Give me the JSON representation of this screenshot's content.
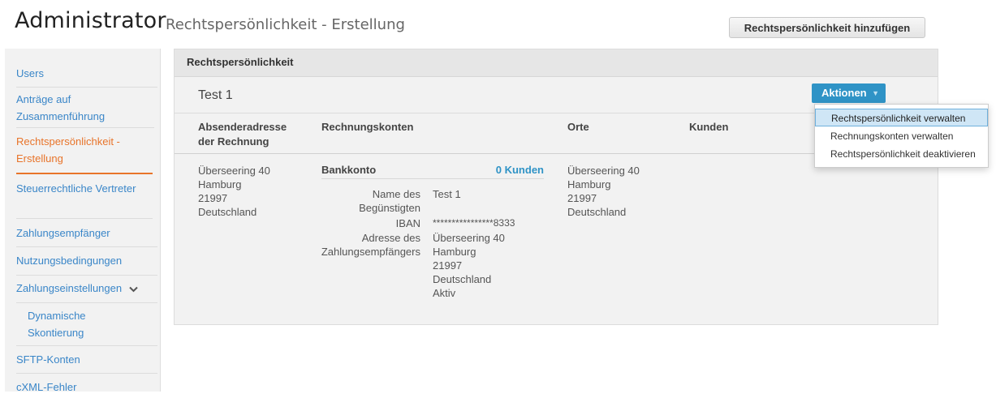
{
  "header": {
    "app_title": "Administrator",
    "page_subtitle": "Rechtspersönlichkeit - Erstellung",
    "add_button_label": "Rechtspersönlichkeit hinzufügen"
  },
  "sidebar": {
    "items": [
      {
        "label": "Users"
      },
      {
        "label": "Anträge auf Zusammenführung"
      },
      {
        "label": "Rechtspersönlichkeit - Erstellung",
        "active": true
      },
      {
        "label": "Steuerrechtliche Vertreter"
      },
      {
        "label": "Zahlungsempfänger"
      },
      {
        "label": "Nutzungsbedingungen"
      },
      {
        "label": "Zahlungseinstellungen",
        "icon": "chevron-down-icon"
      },
      {
        "label": "Dynamische Skontierung",
        "sub": true
      },
      {
        "label": "SFTP-Konten"
      },
      {
        "label": "cXML-Fehler"
      }
    ]
  },
  "panel": {
    "title": "Rechtspersönlichkeit",
    "entity_name": "Test 1",
    "actions_label": "Aktionen",
    "columns": {
      "sender_address": "Absenderadresse der Rechnung",
      "accounts": "Rechnungskonten",
      "locations": "Orte",
      "customers": "Kunden"
    },
    "sender_address_lines": [
      "Überseering 40",
      "Hamburg",
      "21997",
      "Deutschland"
    ],
    "bank": {
      "title": "Bankkonto",
      "customers_link": "0 Kunden",
      "beneficiary_label": "Name des Begünstigten",
      "beneficiary_value": "Test 1",
      "iban_label": "IBAN",
      "iban_value": "****************8333",
      "payee_address_label": "Adresse des Zahlungsempfängers",
      "payee_address_lines": [
        "Überseering 40",
        "Hamburg",
        "21997",
        "Deutschland"
      ],
      "status": "Aktiv"
    },
    "locations_lines": [
      "Überseering 40",
      "Hamburg",
      "21997",
      "Deutschland"
    ]
  },
  "actions_menu": {
    "items": [
      {
        "label": "Rechtspersönlichkeit verwalten",
        "highlighted": true
      },
      {
        "label": "Rechnungskonten verwalten"
      },
      {
        "label": "Rechtspersönlichkeit deaktivieren"
      }
    ]
  },
  "colors": {
    "link": "#3a86c8",
    "active": "#e8742a",
    "accent_button": "#2f93c6"
  }
}
